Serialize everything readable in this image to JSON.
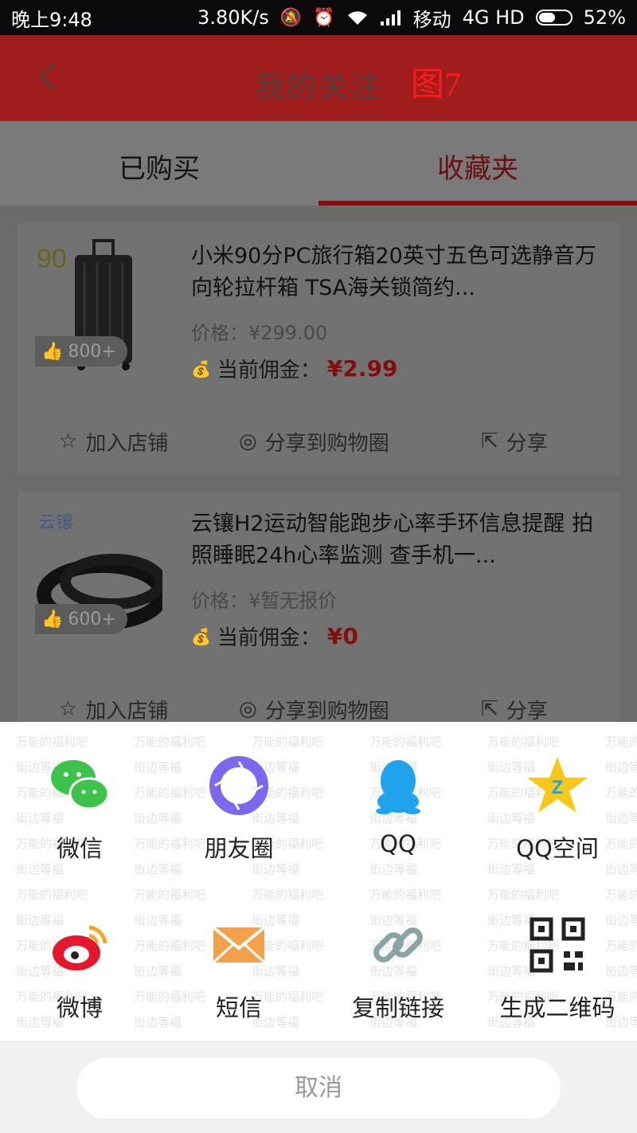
{
  "status_bar": {
    "time": "晚上9:48",
    "speed": "3.80K/s",
    "carrier": "移动",
    "network": "4G HD",
    "battery": "52%",
    "battery_level": 0.52
  },
  "app_bar": {
    "title": "我的关注",
    "figure_label": "图7"
  },
  "tabs": [
    {
      "label": "已购买",
      "active": false
    },
    {
      "label": "收藏夹",
      "active": true
    }
  ],
  "items": [
    {
      "title": "小米90分PC旅行箱20英寸五色可选静音万向轮拉杆箱 TSA海关锁简约...",
      "brand_mark": "90",
      "likes": "800+",
      "price": "价格：¥299.00",
      "commission_label": "当前佣金：",
      "commission_value": "¥2.99"
    },
    {
      "title": "云镶H2运动智能跑步心率手环信息提醒 拍照睡眠24h心率监测 查手机一...",
      "brand_mark": "云镶",
      "likes": "600+",
      "price": "价格：¥暂无报价",
      "commission_label": "当前佣金：",
      "commission_value": "¥0"
    }
  ],
  "actions": {
    "add_store": "加入店铺",
    "share_circle": "分享到购物圈",
    "share": "分享"
  },
  "share_sheet": {
    "options": [
      {
        "label": "微信",
        "icon": "wechat-icon",
        "color": "#3dc24a"
      },
      {
        "label": "朋友圈",
        "icon": "moments-icon",
        "color": "#7b68ee"
      },
      {
        "label": "QQ",
        "icon": "qq-icon",
        "color": "#1fa3ec"
      },
      {
        "label": "QQ空间",
        "icon": "qzone-icon",
        "color": "#f7c81c"
      },
      {
        "label": "微博",
        "icon": "weibo-icon",
        "color": "#e6162d"
      },
      {
        "label": "短信",
        "icon": "sms-icon",
        "color": "#f3a04a"
      },
      {
        "label": "复制链接",
        "icon": "link-icon",
        "color": "#8aa4a4"
      },
      {
        "label": "生成二维码",
        "icon": "qrcode-icon",
        "color": "#222222"
      }
    ],
    "cancel": "取消",
    "watermark_lines": [
      "万能的福利吧",
      "街边等福"
    ]
  },
  "colors": {
    "accent": "#c21b1b",
    "commission": "#e61b1b",
    "dim_overlay": "rgba(0,0,0,0.55)"
  }
}
